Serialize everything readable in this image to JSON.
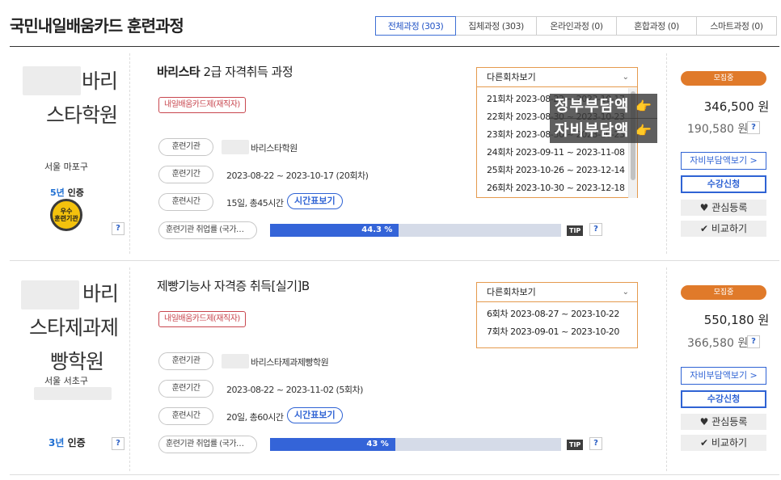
{
  "page_title": "국민내일배움카드 훈련과정",
  "tabs": [
    {
      "label": "전체과정 (303)",
      "active": true
    },
    {
      "label": "집체과정 (303)"
    },
    {
      "label": "온라인과정 (0)"
    },
    {
      "label": "혼합과정 (0)"
    },
    {
      "label": "스마트과정 (0)"
    }
  ],
  "courses": [
    {
      "academy_lines": [
        "바리",
        "스타학원"
      ],
      "location": "서울 마포구",
      "cert_years": "5년",
      "cert_suffix": " 인증",
      "badge_text": "우수\n훈련기관",
      "title_bold": "바리스타",
      "title_rest": " 2급 자격취득 과정",
      "card_type": "내일배움카드제(재직자)",
      "labels": {
        "org": "훈련기관",
        "period": "훈련기간",
        "time": "훈련시간",
        "employment": "훈련기관 취업률 (국가…"
      },
      "org_name": "바리스타학원",
      "period": "2023-08-22 ~ 2023-10-17 (20회차)",
      "hours": "15일, 총45시간",
      "time_btn": "시간표보기",
      "employment_rate": "44.3 %",
      "employment_value": 44.3,
      "tip": "TIP",
      "question": "?",
      "dropdown_title": "다른회차보기",
      "sessions": [
        "21회차 2023-08-22 ~ 2023-10-17",
        "22회차 2023-08-30 ~ 2023-10-23",
        "23회차 2023-08-30 ~ 2023-10-23",
        "24회차 2023-09-11 ~ 2023-11-08",
        "25회차 2023-10-26 ~ 2023-12-14",
        "26회차 2023-10-30 ~ 2023-12-18"
      ],
      "status": "모집중",
      "price_main": "346,500 원",
      "price_sub": "190,580 원",
      "btn_self_pay": "자비부담액보기 >",
      "btn_apply": "수강신청",
      "btn_interest": "관심등록",
      "btn_compare": "비교하기"
    },
    {
      "academy_lines": [
        "바리",
        "스타제과제",
        "빵학원"
      ],
      "location": "서울 서초구",
      "cert_years": "3년",
      "cert_suffix": " 인증",
      "title_bold": "",
      "title_rest": "제빵기능사 자격증 취득[실기]B",
      "card_type": "내일배움카드제(재직자)",
      "labels": {
        "org": "훈련기관",
        "period": "훈련기간",
        "time": "훈련시간",
        "employment": "훈련기관 취업률 (국가…"
      },
      "org_name": "바리스타제과제빵학원",
      "period": "2023-08-22 ~ 2023-11-02 (5회차)",
      "hours": "20일, 총60시간",
      "time_btn": "시간표보기",
      "employment_rate": "43 %",
      "employment_value": 43,
      "tip": "TIP",
      "question": "?",
      "dropdown_title": "다른회차보기",
      "sessions": [
        "6회차 2023-08-27 ~ 2023-10-22",
        "7회차 2023-09-01 ~ 2023-10-20"
      ],
      "status": "모집중",
      "price_main": "550,180 원",
      "price_sub": "366,580 원",
      "btn_self_pay": "자비부담액보기 >",
      "btn_apply": "수강신청",
      "btn_interest": "관심등록",
      "btn_compare": "비교하기"
    }
  ],
  "overlays": {
    "gov_share": "정부부담액",
    "self_share": "자비부담액"
  },
  "icons": {
    "chevron": "chevron-down-icon",
    "hand": "pointing-hand-icon",
    "heart": "heart-icon",
    "check": "check-icon"
  },
  "colors": {
    "accent_blue": "#2f63d4",
    "status_orange": "#e07a2a",
    "card_type_red": "#c8474f",
    "dropdown_border": "#e59a4e"
  }
}
